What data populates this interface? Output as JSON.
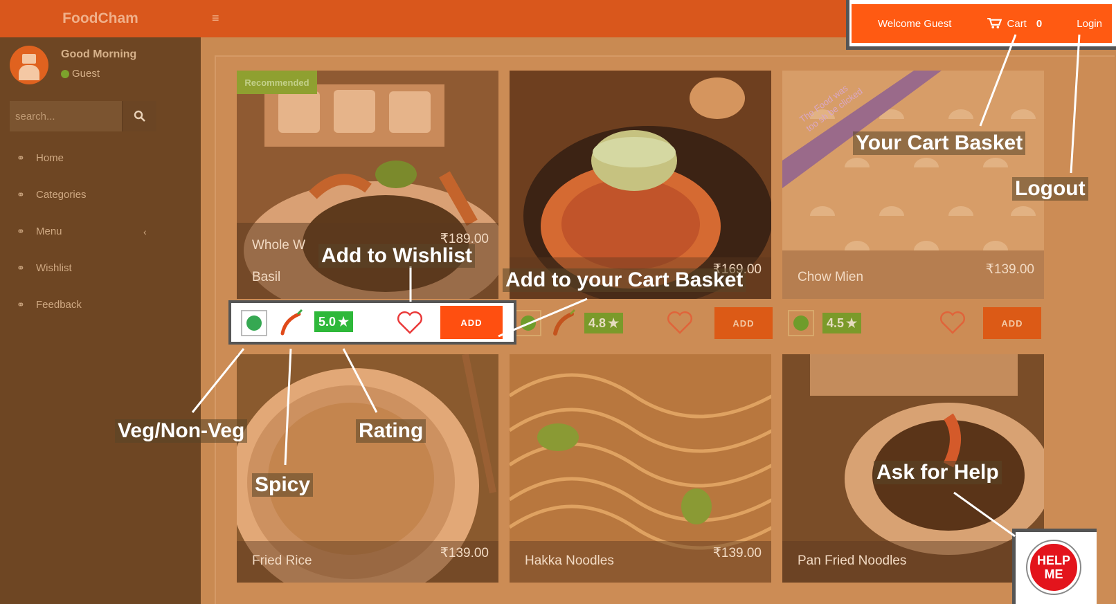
{
  "app": {
    "brand": "FoodCham",
    "menu_toggle": "≡"
  },
  "header": {
    "welcome": "Welcome Guest",
    "cart_label": "Cart",
    "cart_count": "0",
    "login_label": "Login"
  },
  "sidebar": {
    "greeting": "Good Morning",
    "user_status": "Guest",
    "search_placeholder": "search...",
    "items": [
      {
        "label": "Home"
      },
      {
        "label": "Categories"
      },
      {
        "label": "Menu",
        "caret": "‹"
      },
      {
        "label": "Wishlist"
      },
      {
        "label": "Feedback"
      }
    ]
  },
  "cards": [
    {
      "name": "Whole Wheat ... Basil",
      "name_line1": "Whole W",
      "name_line2": "Basil",
      "price": "₹189.00",
      "rating": "5.0",
      "ribbon": "Recommended",
      "add_label": "ADD"
    },
    {
      "name": "",
      "price": "₹169.00",
      "rating": "4.8",
      "add_label": "ADD"
    },
    {
      "name": "Chow Mien",
      "price": "₹139.00",
      "rating": "4.5",
      "ribbon": "The Food was too shy to be clicked",
      "ribbon_line1": "The Food was",
      "ribbon_line2": "too sh   be clicked",
      "add_label": "ADD"
    },
    {
      "name": "Fried Rice",
      "price": "₹139.00"
    },
    {
      "name": "Hakka Noodles",
      "price": "₹139.00"
    },
    {
      "name": "Pan Fried Noodles",
      "price": ""
    }
  ],
  "help_button": {
    "line1": "HELP",
    "line2": "ME"
  },
  "annotations": {
    "wishlist": "Add to Wishlist",
    "cart_basket": "Add to your Cart Basket",
    "your_cart": "Your Cart Basket",
    "logout": "Logout",
    "veg": "Veg/Non-Veg",
    "rating": "Rating",
    "spicy": "Spicy",
    "help": "Ask for Help"
  },
  "colors": {
    "accent": "#ff5a12",
    "sidebar": "#6e4623",
    "rating_green": "#2eb83a",
    "help_red": "#e3141c"
  }
}
